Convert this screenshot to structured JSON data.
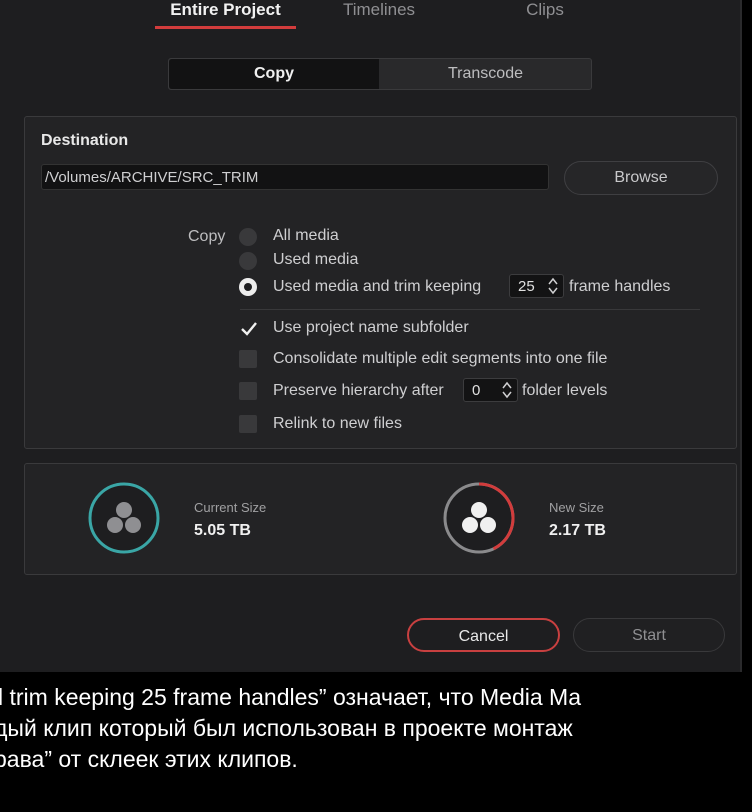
{
  "tabs": [
    "Entire Project",
    "Timelines",
    "Clips"
  ],
  "mode_buttons": {
    "copy": "Copy",
    "transcode": "Transcode"
  },
  "destination": {
    "label": "Destination",
    "path": "/Volumes/ARCHIVE/SRC_TRIM",
    "browse": "Browse"
  },
  "copy_options": {
    "label": "Copy",
    "all_media": "All media",
    "used_media": "Used media",
    "used_trim": "Used media and trim keeping",
    "frame_handles_value": "25",
    "frame_handles_suffix": "frame handles",
    "selected": "used_trim"
  },
  "checkboxes": {
    "subfolder": {
      "label": "Use project name subfolder",
      "checked": true
    },
    "consolidate": {
      "label": "Consolidate multiple edit segments into one file",
      "checked": false
    },
    "preserve": {
      "label": "Preserve hierarchy after",
      "value": "0",
      "suffix": "folder levels",
      "checked": false
    },
    "relink": {
      "label": "Relink to new files",
      "checked": false
    }
  },
  "sizes": {
    "current": {
      "label": "Current Size",
      "value": "5.05 TB"
    },
    "new": {
      "label": "New Size",
      "value": "2.17 TB",
      "fraction": 0.43
    }
  },
  "actions": {
    "cancel": "Cancel",
    "start": "Start"
  },
  "caption": [
    "l trim keeping 25 frame handles” означает, что Media Ma",
    "дый клип который был использован в проекте монтаж",
    "рава” от склеек этих клипов."
  ],
  "colors": {
    "accent_red": "#d23c3c",
    "teal": "#3aa6a6",
    "panel": "#1e1e20"
  }
}
